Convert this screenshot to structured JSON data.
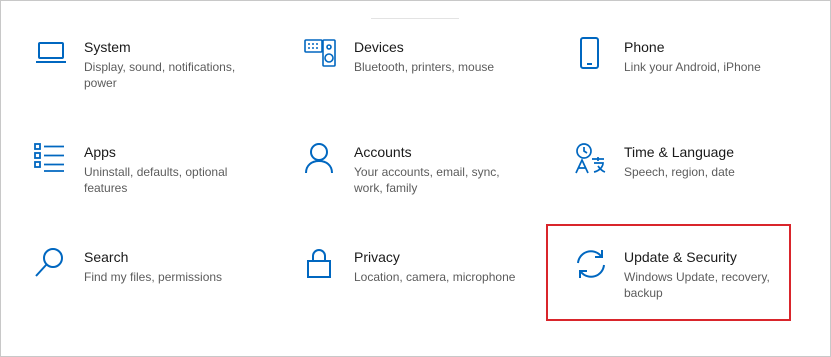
{
  "colors": {
    "accent": "#0067c0",
    "title": "#1a1a1a",
    "desc": "#5c5c5c",
    "highlight": "#d9252b"
  },
  "tiles": [
    {
      "icon": "laptop-icon",
      "title": "System",
      "desc": "Display, sound, notifications, power"
    },
    {
      "icon": "keyboard-speaker-icon",
      "title": "Devices",
      "desc": "Bluetooth, printers, mouse"
    },
    {
      "icon": "phone-icon",
      "title": "Phone",
      "desc": "Link your Android, iPhone"
    },
    {
      "icon": "apps-list-icon",
      "title": "Apps",
      "desc": "Uninstall, defaults, optional features"
    },
    {
      "icon": "person-icon",
      "title": "Accounts",
      "desc": "Your accounts, email, sync, work, family"
    },
    {
      "icon": "time-language-icon",
      "title": "Time & Language",
      "desc": "Speech, region, date"
    },
    {
      "icon": "search-icon",
      "title": "Search",
      "desc": "Find my files, permissions"
    },
    {
      "icon": "lock-icon",
      "title": "Privacy",
      "desc": "Location, camera, microphone"
    },
    {
      "icon": "sync-arrows-icon",
      "title": "Update & Security",
      "desc": "Windows Update, recovery, backup"
    }
  ]
}
